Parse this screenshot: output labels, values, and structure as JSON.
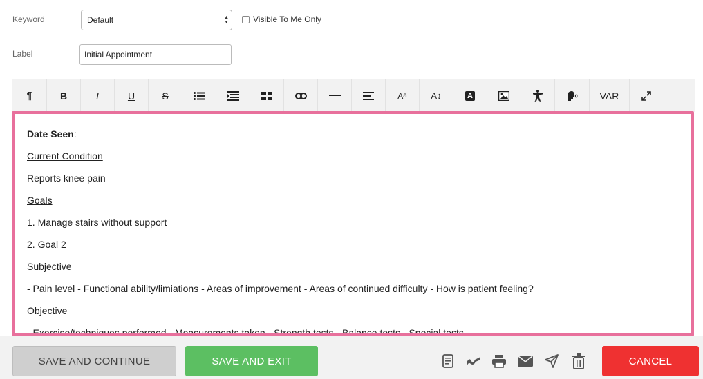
{
  "form": {
    "keyword_label": "Keyword",
    "keyword_value": "Default",
    "visible_label": "Visible To Me Only",
    "label_label": "Label",
    "label_value": "Initial Appointment"
  },
  "toolbar": {
    "buttons": [
      {
        "name": "paragraph-icon",
        "glyph": "¶"
      },
      {
        "name": "bold-icon",
        "glyph": "B"
      },
      {
        "name": "italic-icon",
        "glyph": "I"
      },
      {
        "name": "underline-icon",
        "glyph": "U"
      },
      {
        "name": "strikethrough-icon",
        "glyph": "S"
      },
      {
        "name": "list-icon",
        "glyph": ""
      },
      {
        "name": "paragraph-format-icon",
        "glyph": ""
      },
      {
        "name": "table-icon",
        "glyph": ""
      },
      {
        "name": "link-icon",
        "glyph": ""
      },
      {
        "name": "horizontal-line-icon",
        "glyph": "—"
      },
      {
        "name": "align-icon",
        "glyph": ""
      },
      {
        "name": "font-size-icon",
        "glyph": "Aa"
      },
      {
        "name": "line-height-icon",
        "glyph": "A↕"
      },
      {
        "name": "text-color-icon",
        "glyph": "A"
      },
      {
        "name": "image-icon",
        "glyph": ""
      },
      {
        "name": "accessibility-icon",
        "glyph": ""
      },
      {
        "name": "speech-icon",
        "glyph": ""
      },
      {
        "name": "variable-icon",
        "glyph": "VAR"
      },
      {
        "name": "fullscreen-icon",
        "glyph": "⤢"
      }
    ]
  },
  "editor": {
    "date_seen_label": "Date Seen",
    "date_seen_colon": ":",
    "current_condition": "Current Condition",
    "reports": "Reports knee pain",
    "goals": "Goals",
    "goal1": "1. Manage stairs without support",
    "goal2": "2. Goal 2",
    "subjective": "Subjective",
    "subjective_text": "- Pain level - Functional ability/limiations - Areas of improvement - Areas of continued difficulty - How is patient feeling?",
    "objective": "Objective",
    "objective_text": "- Exercise/techniques performed - Measurements taken - Strength tests - Balance tests - Special tests"
  },
  "footer": {
    "save_continue": "SAVE AND CONTINUE",
    "save_exit": "SAVE AND EXIT",
    "cancel": "CANCEL"
  }
}
